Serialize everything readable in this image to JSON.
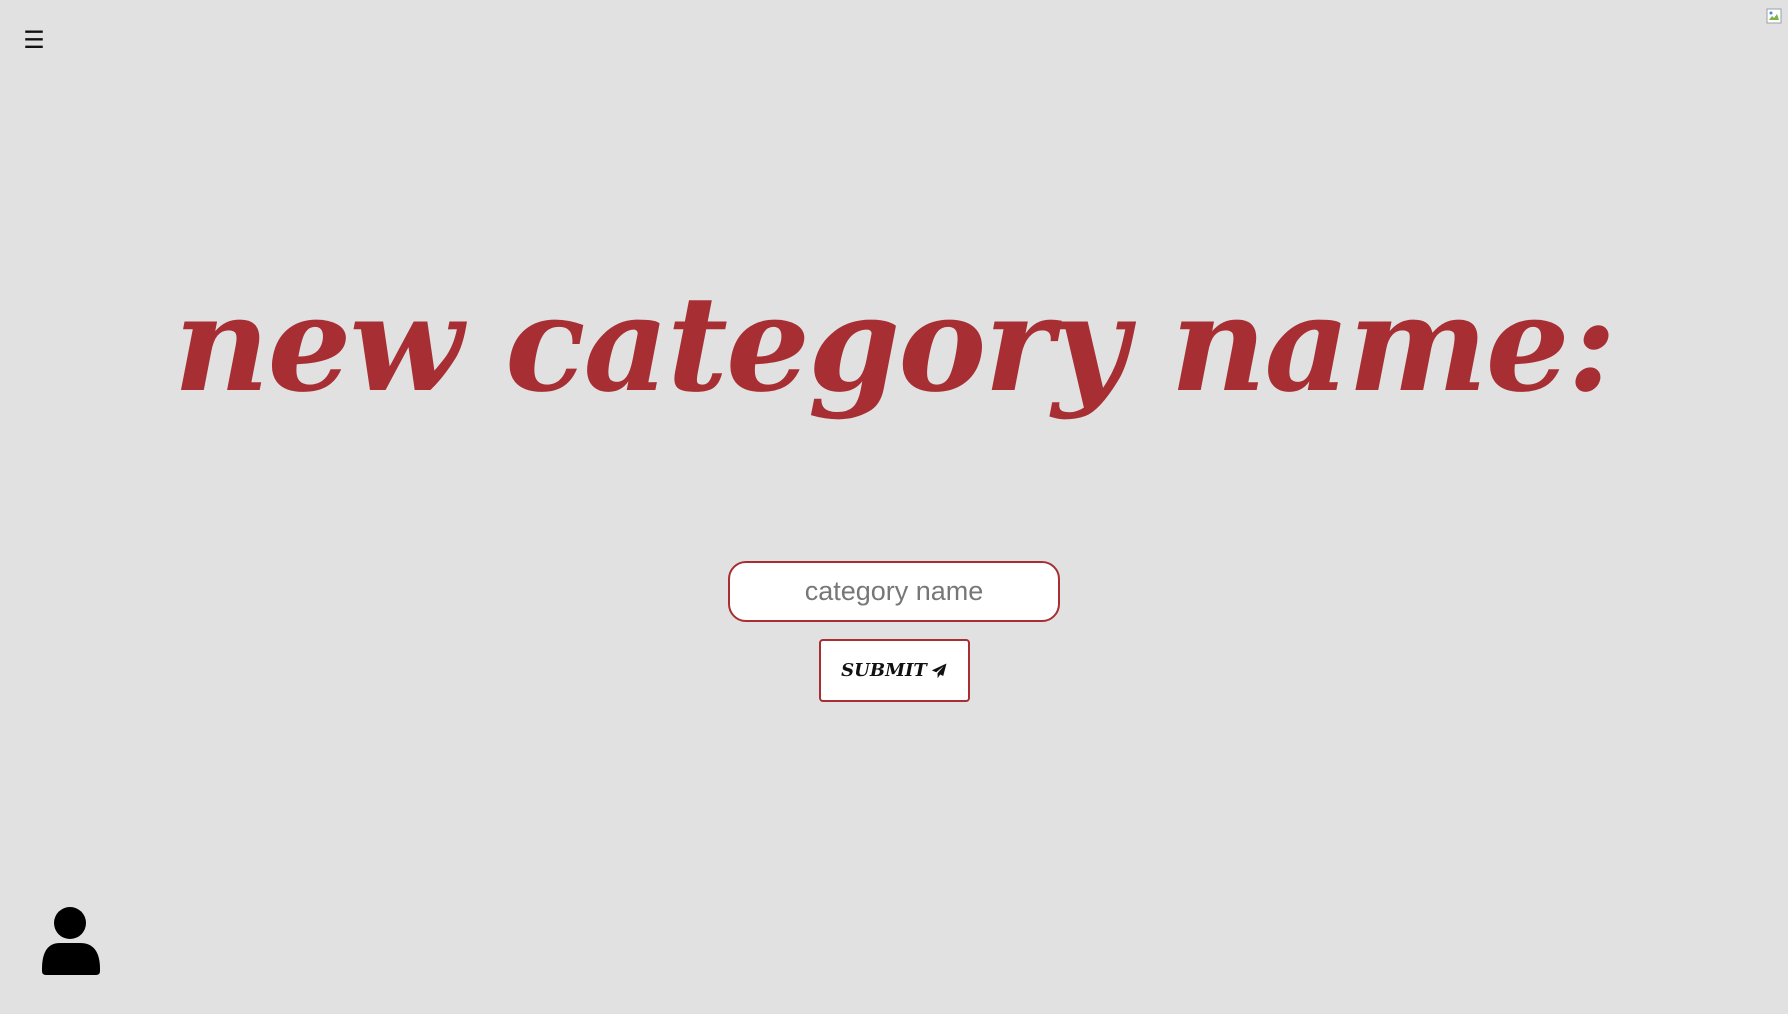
{
  "header": {
    "menu_icon": "hamburger-menu-icon",
    "menu_glyph": "☰",
    "top_right_image": "broken-image-icon"
  },
  "main": {
    "heading": "new category name:",
    "input": {
      "value": "",
      "placeholder": "category name"
    },
    "submit": {
      "label": "SUBMIT",
      "icon": "paper-plane-icon"
    }
  },
  "footer": {
    "profile_icon": "user-icon"
  },
  "colors": {
    "background": "#e1e1e1",
    "accent": "#a72f33",
    "text": "#111111",
    "input_background": "#ffffff",
    "placeholder": "#777777"
  }
}
